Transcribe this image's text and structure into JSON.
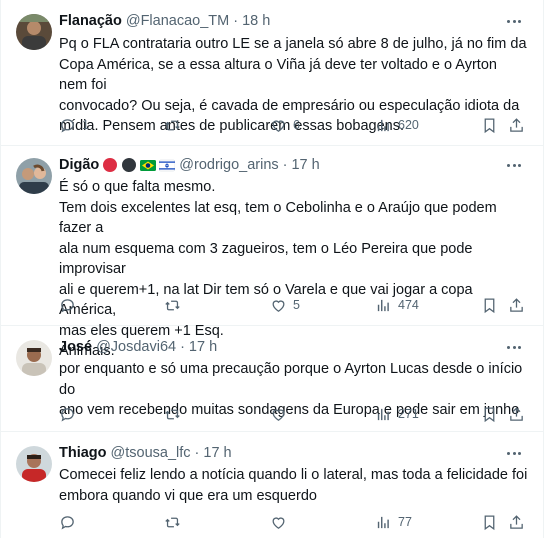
{
  "tweets": [
    {
      "name": "Flanação",
      "handle": "@Flanacao_TM",
      "time": "18 h",
      "text": "Pq o FLA contrataria outro LE se a janela só abre 8 de julho, já no fim da\nCopa América, se a essa altura o Viña já deve ter voltado e o Ayrton nem foi\nconvocado? Ou seja, é cavada de empresário ou especulação idiota da\nmídia. Pensem antes de publicarem essas bobagens.",
      "replies": "1",
      "reposts": "",
      "likes": "6",
      "views": "620"
    },
    {
      "name": "Digão",
      "handle": "@rodrigo_arins",
      "time": "17 h",
      "name_emojis": [
        "red-circle-icon",
        "black-circle-icon",
        "brazil-flag-icon",
        "israel-flag-icon"
      ],
      "text": "É só o que falta mesmo.\nTem dois excelentes lat esq, tem o Cebolinha e o Araújo que podem fazer a\nala num esquema com 3 zagueiros, tem o Léo Pereira que pode improvisar\nali e querem+1, na lat Dir tem só o Varela e que vai jogar a copa América,\nmas eles querem +1 Esq.\nAnimais.",
      "replies": "",
      "reposts": "",
      "likes": "5",
      "views": "474"
    },
    {
      "name": "José",
      "handle": "@Josdavi64",
      "time": "17 h",
      "text": "por enquanto e só uma precaução porque o Ayrton Lucas desde o início do\nano vem recebendo muitas sondagens da Europa e pode sair em junho",
      "replies": "",
      "reposts": "",
      "likes": "",
      "views": "271"
    },
    {
      "name": "Thiago",
      "handle": "@tsousa_lfc",
      "time": "17 h",
      "text": "Comecei feliz lendo a notícia quando li o lateral, mas toda a felicidade foi\nembora quando vi que era um esquerdo",
      "replies": "",
      "reposts": "",
      "likes": "",
      "views": "77"
    }
  ],
  "colors": {
    "text": "#0f1419",
    "secondary": "#536471",
    "border": "#eff3f4"
  },
  "separator": "·"
}
